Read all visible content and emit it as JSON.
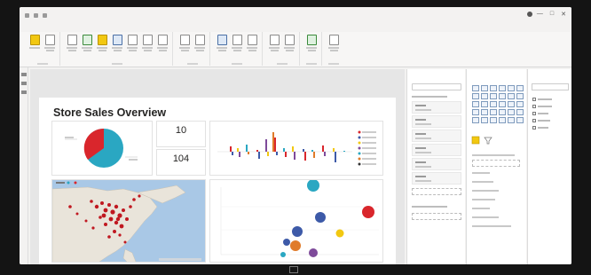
{
  "window": {
    "title": "",
    "user": "",
    "controls": [
      "—",
      "□",
      "✕"
    ]
  },
  "menu": {
    "tabs": [
      "",
      "",
      "",
      "",
      ""
    ],
    "active_index": 1
  },
  "report": {
    "title": "Store Sales Overview",
    "kpis": [
      {
        "value": "10",
        "label": ""
      },
      {
        "value": "104",
        "label": ""
      }
    ]
  },
  "panes": {
    "filters_title": "",
    "visualizations_title": "",
    "fields_title": ""
  },
  "colors": {
    "accent": "#f2c811",
    "pie_red": "#d9262c",
    "pie_teal": "#2aa7c2",
    "map_red": "#c01820",
    "ocean": "#a9c8e6"
  }
}
